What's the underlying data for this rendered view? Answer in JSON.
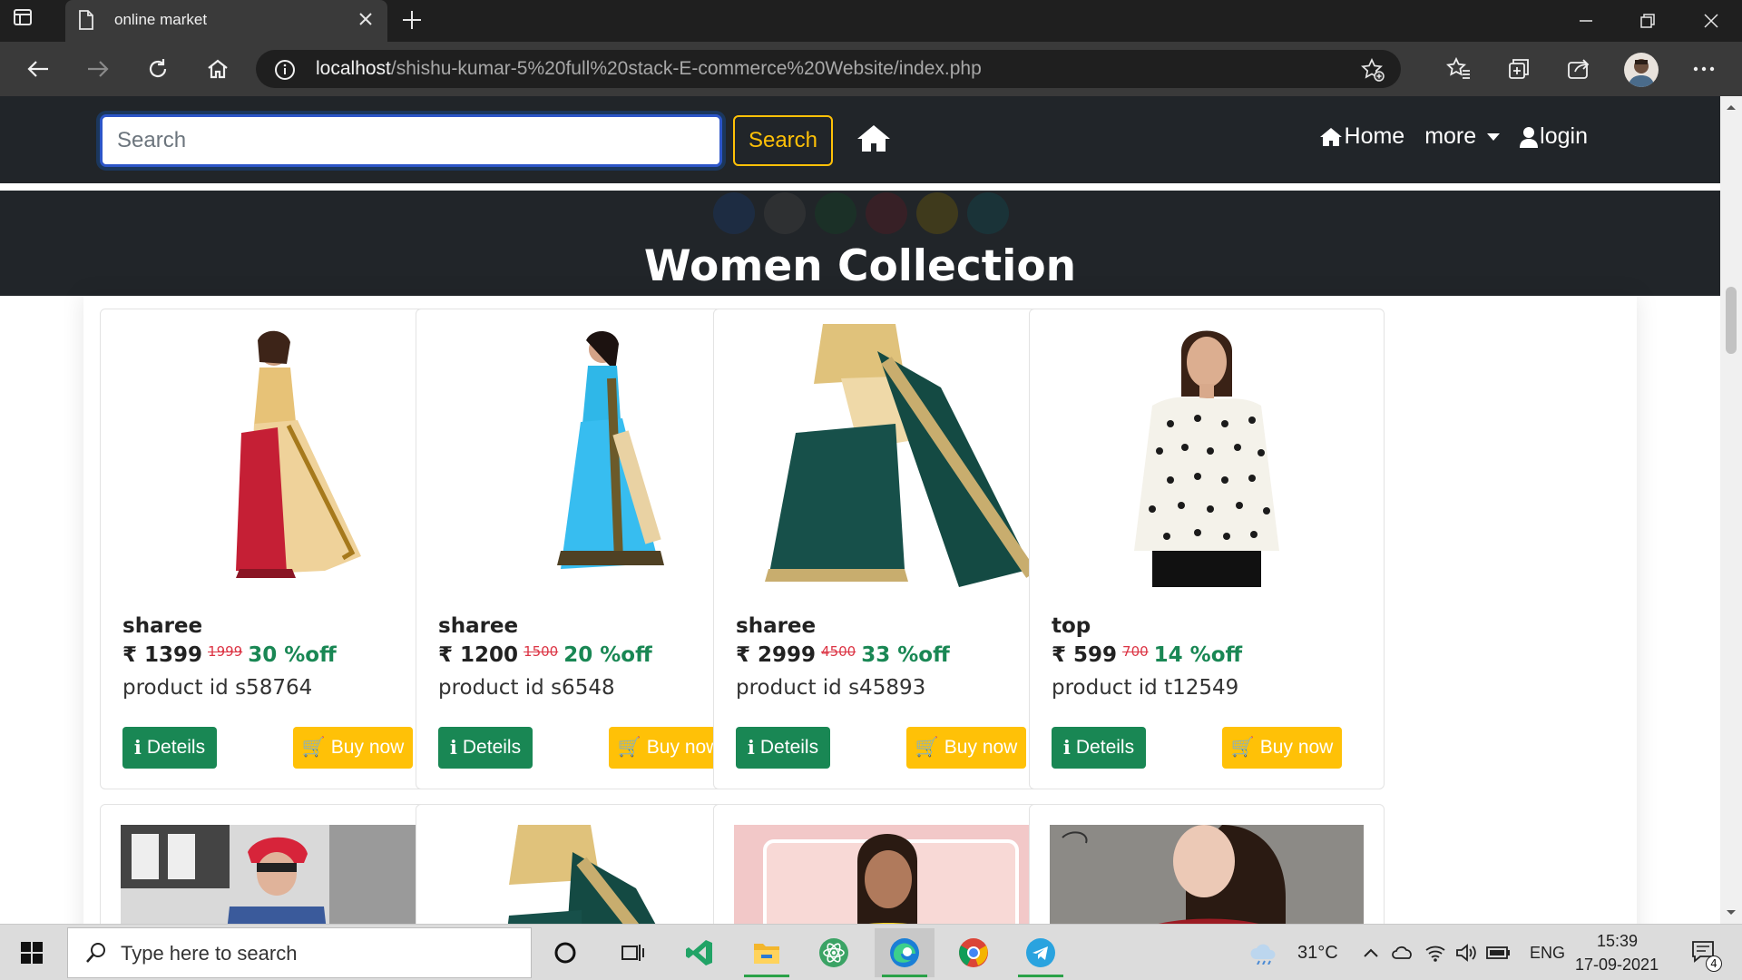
{
  "browser": {
    "tab_title": "online market",
    "url_host": "localhost",
    "url_path": "/shishu-kumar-5%20full%20stack-E-commerce%20Website/index.php"
  },
  "site": {
    "search_placeholder": "Search",
    "search_button": "Search",
    "nav": {
      "home": "Home",
      "more": "more",
      "login": "login"
    },
    "collection_title": "Women Collection"
  },
  "products": [
    {
      "name": "sharee",
      "price": "₹ 1399",
      "mrp": "1999",
      "off": "30 %off",
      "product_id": "product id s58764",
      "details_label": "Deteils",
      "buy_label": "Buy now"
    },
    {
      "name": "sharee",
      "price": "₹ 1200",
      "mrp": "1500",
      "off": "20 %off",
      "product_id": "product id s6548",
      "details_label": "Deteils",
      "buy_label": "Buy now"
    },
    {
      "name": "sharee",
      "price": "₹ 2999",
      "mrp": "4500",
      "off": "33 %off",
      "product_id": "product id s45893",
      "details_label": "Deteils",
      "buy_label": "Buy now"
    },
    {
      "name": "top",
      "price": "₹ 599",
      "mrp": "700",
      "off": "14 %off",
      "product_id": "product id t12549",
      "details_label": "Deteils",
      "buy_label": "Buy now"
    }
  ],
  "taskbar": {
    "search_placeholder": "Type here to search",
    "weather": "31°C",
    "language": "ENG",
    "time": "15:39",
    "date": "17-09-2021",
    "notifications": "4"
  },
  "colors": {
    "navbar": "#212529",
    "accent_yellow": "#ffc107",
    "details_green": "#198754",
    "mrp_red": "#dc3545"
  }
}
